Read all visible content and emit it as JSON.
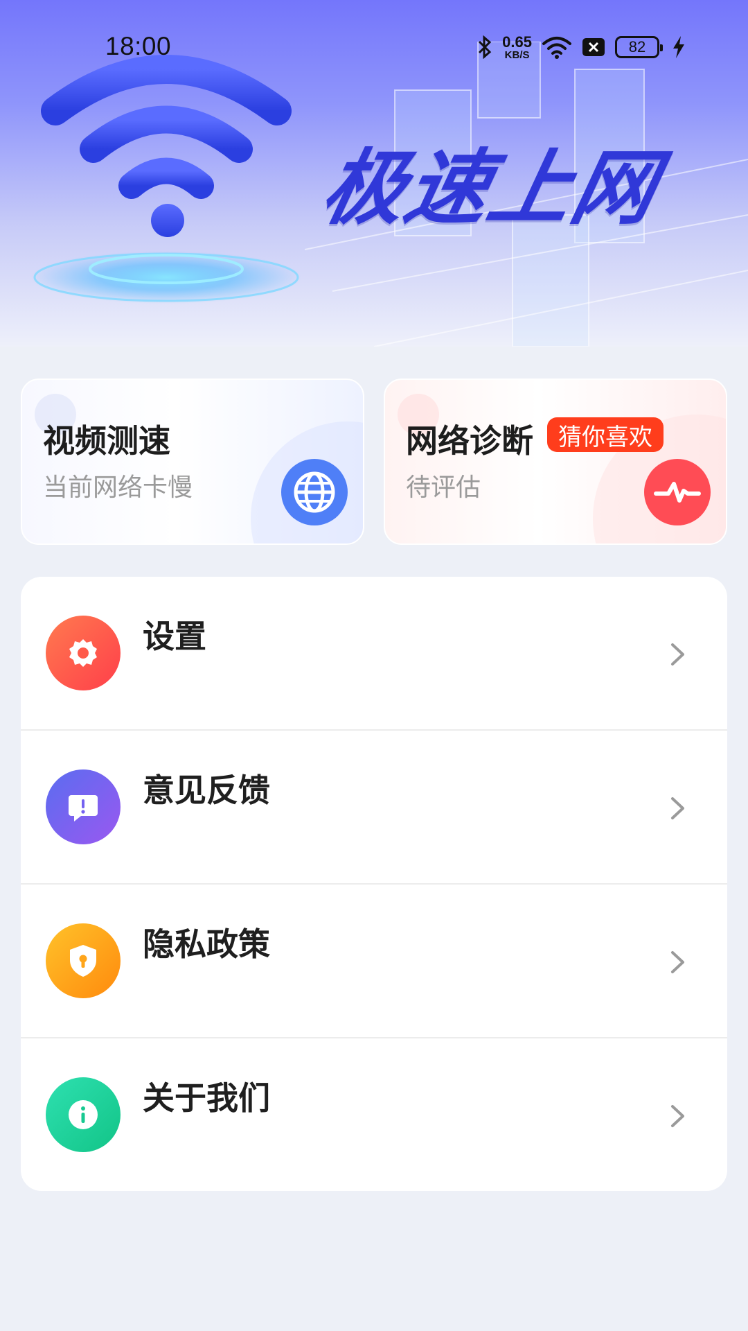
{
  "status_bar": {
    "time": "18:00",
    "net_speed_value": "0.65",
    "net_speed_unit": "KB/S",
    "battery": "82",
    "icons": [
      "bluetooth-icon",
      "wifi-icon",
      "close-badge-icon",
      "battery-icon",
      "charging-icon"
    ]
  },
  "hero": {
    "title": "极速上网"
  },
  "cards": [
    {
      "title": "视频测速",
      "subtitle": "当前网络卡慢",
      "icon": "globe-icon",
      "color": "#4f7ff7"
    },
    {
      "title": "网络诊断",
      "badge": "猜你喜欢",
      "subtitle": "待评估",
      "icon": "pulse-icon",
      "color": "#ff4c55"
    }
  ],
  "menu": [
    {
      "label": "设置",
      "icon": "gear-icon",
      "colors": [
        "#ff7a4f",
        "#ff3f4a"
      ]
    },
    {
      "label": "意见反馈",
      "icon": "feedback-icon",
      "colors": [
        "#5a6df0",
        "#9a58f0"
      ]
    },
    {
      "label": "隐私政策",
      "icon": "shield-icon",
      "colors": [
        "#ffc22a",
        "#ff8a0d"
      ]
    },
    {
      "label": "关于我们",
      "icon": "info-icon",
      "colors": [
        "#2ee0b0",
        "#12c487"
      ]
    }
  ]
}
